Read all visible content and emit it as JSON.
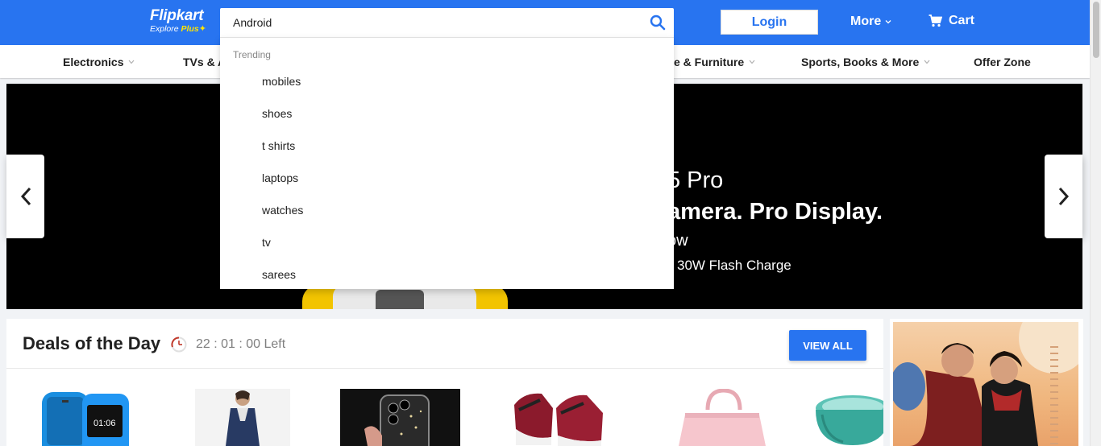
{
  "header": {
    "brand": "Flipkart",
    "tagline_main": "Explore",
    "tagline_plus": "Plus",
    "search_value": "Android",
    "login_label": "Login",
    "more_label": "More",
    "cart_label": "Cart",
    "accent_color": "#2874f0"
  },
  "categories": [
    {
      "label": "Electronics",
      "has_chevron": true
    },
    {
      "label": "TVs & A",
      "has_chevron": false
    },
    {
      "label": "e & Furniture",
      "has_chevron": true
    },
    {
      "label": "Sports, Books & More",
      "has_chevron": true
    },
    {
      "label": "Offer Zone",
      "has_chevron": false
    }
  ],
  "banner": {
    "line1": "5 Pro",
    "line2": "amera. Pro Display.",
    "line3": "ow",
    "line4": "30W Flash Charge"
  },
  "search_dropdown": {
    "heading": "Trending",
    "items": [
      "mobiles",
      "shoes",
      "t shirts",
      "laptops",
      "watches",
      "tv",
      "sarees"
    ]
  },
  "deals": {
    "title": "Deals of the Day",
    "timer": "22 : 01 : 00 Left",
    "view_all_label": "VIEW ALL",
    "products": [
      {
        "name": "feature-phone"
      },
      {
        "name": "kurta"
      },
      {
        "name": "phone-case"
      },
      {
        "name": "sneakers"
      },
      {
        "name": "handbag"
      },
      {
        "name": "kitchen-appliance"
      }
    ]
  }
}
